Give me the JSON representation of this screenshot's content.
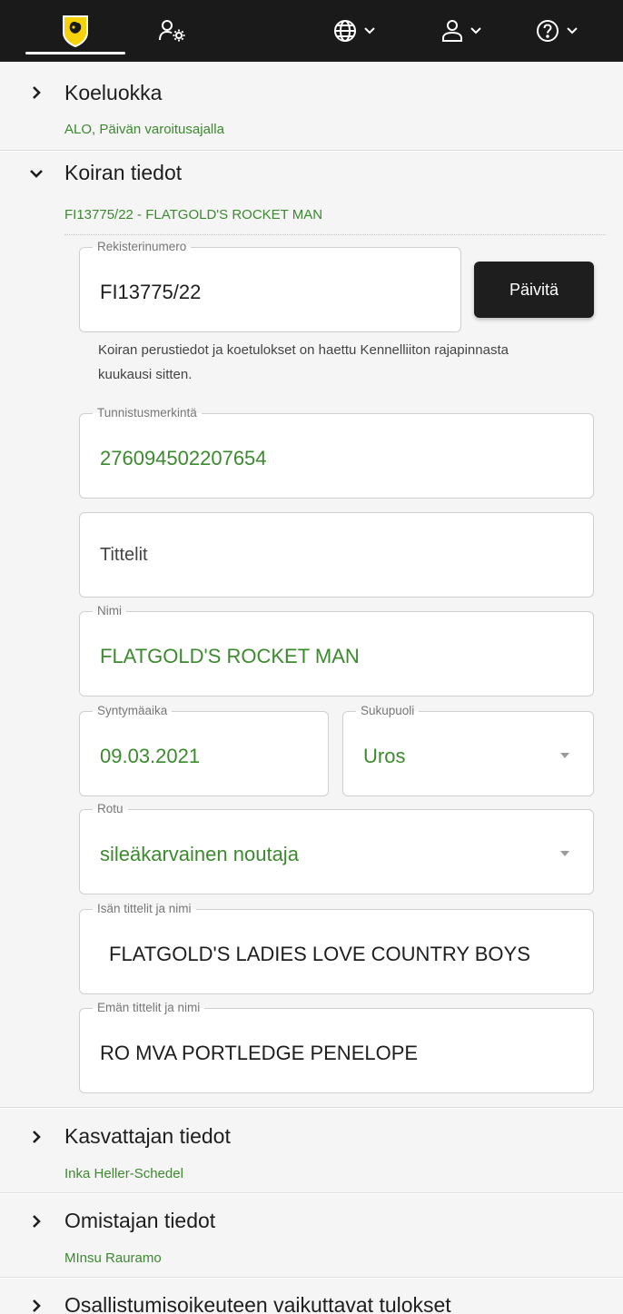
{
  "topbar": {
    "logo_icon": "dog-shield-logo-icon",
    "admin_icon": "users-settings-icon",
    "language_icon": "globe-icon",
    "user_icon": "user-icon",
    "help_icon": "help-circle-icon",
    "dropdown_icon": "chevron-down-icon",
    "background": "#1a1a1a"
  },
  "sections": {
    "koeluokka": {
      "title": "Koeluokka",
      "subtitle": "ALO, Päivän varoitusajalla",
      "expanded": false
    },
    "koiran_tiedot": {
      "title": "Koiran tiedot",
      "subtitle": "FI13775/22 - FLATGOLD'S ROCKET MAN",
      "expanded": true
    },
    "kasvattajan_tiedot": {
      "title": "Kasvattajan tiedot",
      "subtitle": "Inka Heller-Schedel",
      "expanded": false
    },
    "omistajan_tiedot": {
      "title": "Omistajan tiedot",
      "subtitle": "MInsu Rauramo",
      "expanded": false
    },
    "osallistumisoikeus": {
      "title": "Osallistumisoikeuteen vaikuttavat tulokset",
      "expanded": false
    }
  },
  "dog_form": {
    "registration": {
      "label": "Rekisterinumero",
      "value": "FI13775/22"
    },
    "update_button": "Päivitä",
    "note": "Koiran perustiedot ja koetulokset on haettu Kennelliiton rajapinnasta kuukausi sitten.",
    "identification": {
      "label": "Tunnistusmerkintä",
      "value": "276094502207654"
    },
    "titles": {
      "placeholder": "Tittelit"
    },
    "name": {
      "label": "Nimi",
      "value": "FLATGOLD'S ROCKET MAN"
    },
    "birth_date": {
      "label": "Syntymäaika",
      "value": "09.03.2021"
    },
    "sex": {
      "label": "Sukupuoli",
      "value": "Uros"
    },
    "breed": {
      "label": "Rotu",
      "value": "sileäkarvainen noutaja"
    },
    "sire": {
      "label": "Isän tittelit ja nimi",
      "value": "FLATGOLD'S LADIES LOVE COUNTRY BOYS"
    },
    "dam": {
      "label": "Emän tittelit ja nimi",
      "value": "RO MVA PORTLEDGE PENELOPE"
    }
  },
  "colors": {
    "accent_green": "#3b8a2e",
    "panel_bg": "#f5f5f5",
    "button_bg": "#1e1e1e"
  }
}
